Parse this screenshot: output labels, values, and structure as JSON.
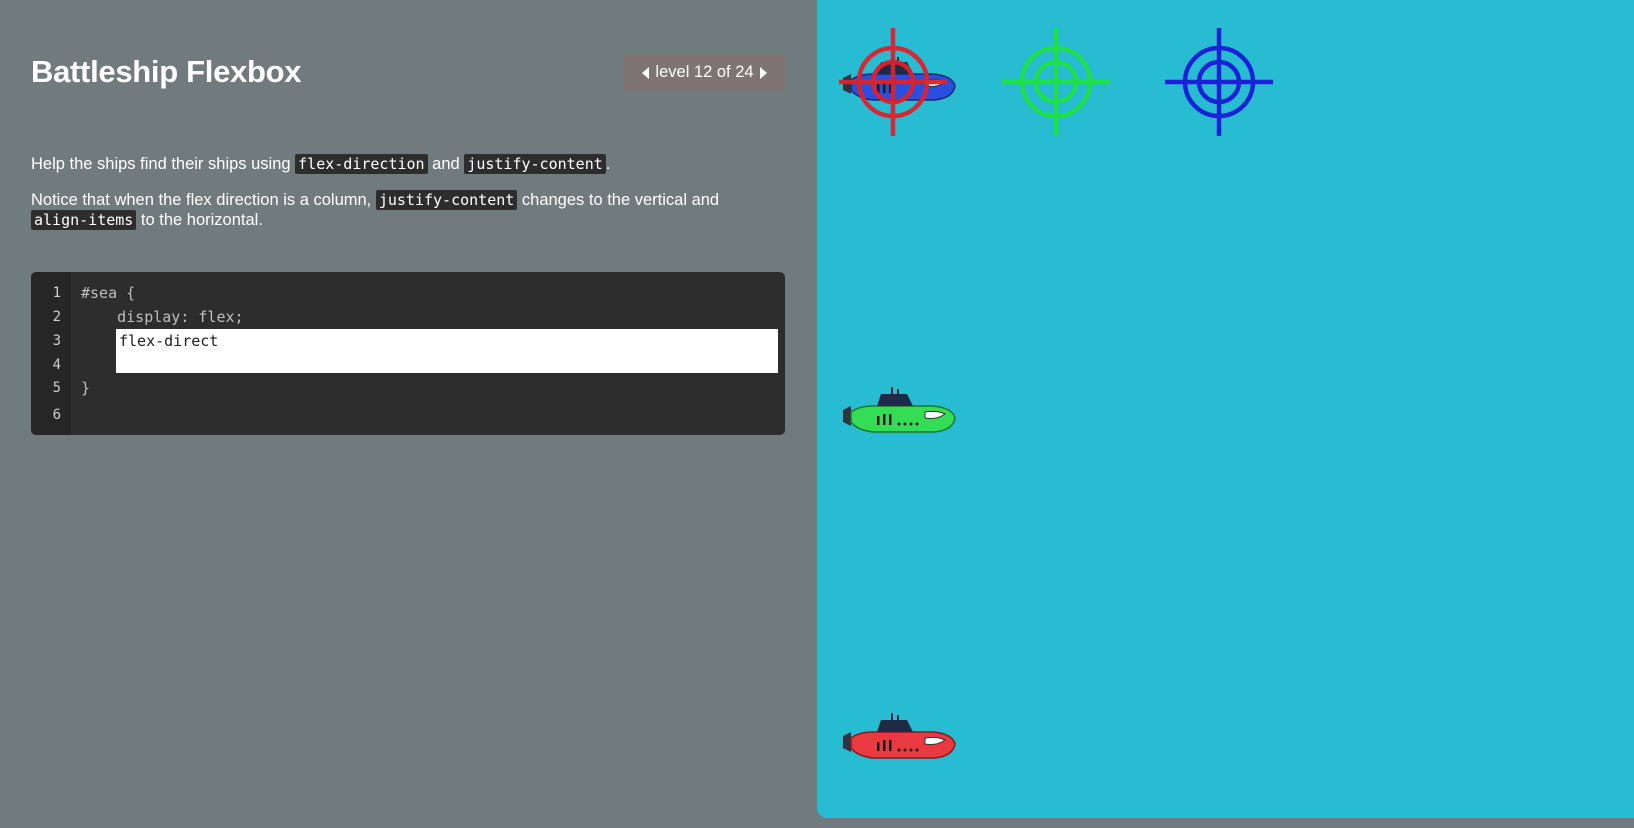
{
  "app": {
    "title": "Battleship Flexbox",
    "level_text": "level 12 of 24"
  },
  "instructions": {
    "p1_pre": "Help the ships find their ships using ",
    "p1_code1": "flex-direction",
    "p1_mid": " and ",
    "p1_code2": "justify-content",
    "p1_post": ".",
    "p2_pre": "Notice that when the flex direction is a column, ",
    "p2_code1": "justify-content",
    "p2_mid": " changes to the vertical and ",
    "p2_code2": "align-items",
    "p2_post": " to the horizontal."
  },
  "editor": {
    "line_numbers": [
      "1",
      "2",
      "3",
      "4",
      "5",
      "6"
    ],
    "line1": "#sea {",
    "line2": "    display: flex;",
    "line5": "}",
    "input_value": "flex-direct"
  },
  "sea": {
    "targets": [
      {
        "color": "red",
        "hex": "#e0202a"
      },
      {
        "color": "green",
        "hex": "#1fe04a"
      },
      {
        "color": "blue",
        "hex": "#1a22d8"
      }
    ],
    "ships": [
      {
        "color": "blue",
        "hex": "#2a4fe0"
      },
      {
        "color": "green",
        "hex": "#33dd55"
      },
      {
        "color": "red",
        "hex": "#e83a40"
      }
    ]
  },
  "colors": {
    "panel_bg": "#717a7d",
    "sea_bg": "#27bcd2",
    "editor_bg": "#2d2d2d",
    "level_nav_bg": "#7e7474"
  }
}
